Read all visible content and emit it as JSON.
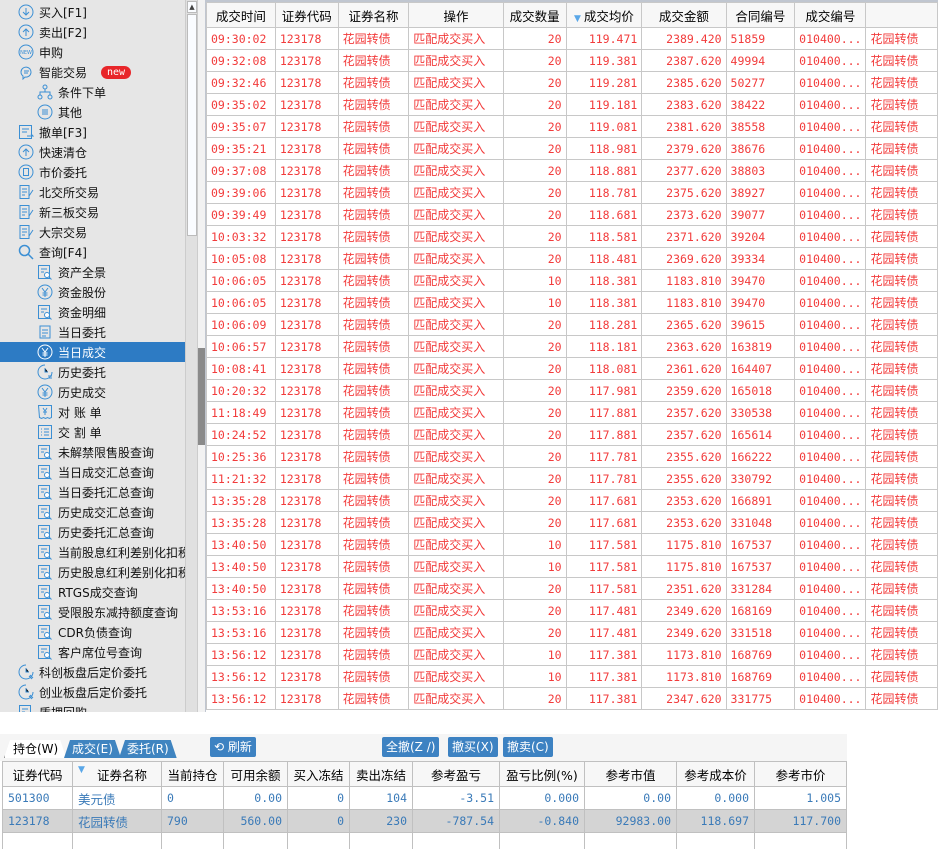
{
  "sidebar": {
    "items": [
      {
        "label": "买入[F1]",
        "level": 0,
        "icon": "buy-icon"
      },
      {
        "label": "卖出[F2]",
        "level": 0,
        "icon": "sell-icon"
      },
      {
        "label": "申购",
        "level": 0,
        "icon": "new-icon"
      },
      {
        "label": "智能交易",
        "level": 0,
        "icon": "smart-trade-icon",
        "badge": "new"
      },
      {
        "label": "条件下单",
        "level": 1,
        "icon": "tree-icon"
      },
      {
        "label": "其他",
        "level": 1,
        "icon": "list-circle-icon"
      },
      {
        "label": "撤单[F3]",
        "level": 0,
        "icon": "cancel-order-icon"
      },
      {
        "label": "快速清仓",
        "level": 0,
        "icon": "sell-icon"
      },
      {
        "label": "市价委托",
        "level": 0,
        "icon": "market-order-icon"
      },
      {
        "label": "北交所交易",
        "level": 0,
        "icon": "document-edit-icon"
      },
      {
        "label": "新三板交易",
        "level": 0,
        "icon": "document-edit-icon"
      },
      {
        "label": "大宗交易",
        "level": 0,
        "icon": "document-edit-icon"
      },
      {
        "label": "查询[F4]",
        "level": 0,
        "icon": "search-icon"
      },
      {
        "label": "资产全景",
        "level": 1,
        "icon": "report-search-icon"
      },
      {
        "label": "资金股份",
        "level": 1,
        "icon": "yuan-icon"
      },
      {
        "label": "资金明细",
        "level": 1,
        "icon": "report-search-icon"
      },
      {
        "label": "当日委托",
        "level": 1,
        "icon": "order-icon"
      },
      {
        "label": "当日成交",
        "level": 1,
        "icon": "yuan-icon",
        "selected": true
      },
      {
        "label": "历史委托",
        "level": 1,
        "icon": "history-icon"
      },
      {
        "label": "历史成交",
        "level": 1,
        "icon": "yuan-icon"
      },
      {
        "label": "对 账 单",
        "level": 1,
        "icon": "statement-icon"
      },
      {
        "label": "交 割 单",
        "level": 1,
        "icon": "list-icon"
      },
      {
        "label": "未解禁限售股查询",
        "level": 1,
        "icon": "report-search-icon"
      },
      {
        "label": "当日成交汇总查询",
        "level": 1,
        "icon": "report-search-icon"
      },
      {
        "label": "当日委托汇总查询",
        "level": 1,
        "icon": "report-search-icon"
      },
      {
        "label": "历史成交汇总查询",
        "level": 1,
        "icon": "report-search-icon"
      },
      {
        "label": "历史委托汇总查询",
        "level": 1,
        "icon": "report-search-icon"
      },
      {
        "label": "当前股息红利差别化扣税",
        "level": 1,
        "icon": "report-search-icon"
      },
      {
        "label": "历史股息红利差别化扣税",
        "level": 1,
        "icon": "report-search-icon"
      },
      {
        "label": "RTGS成交查询",
        "level": 1,
        "icon": "report-search-icon"
      },
      {
        "label": "受限股东减持额度查询",
        "level": 1,
        "icon": "report-search-icon"
      },
      {
        "label": "CDR负债查询",
        "level": 1,
        "icon": "report-search-icon"
      },
      {
        "label": "客户席位号查询",
        "level": 1,
        "icon": "report-search-icon"
      },
      {
        "label": "科创板盘后定价委托",
        "level": 0,
        "icon": "clock-icon"
      },
      {
        "label": "创业板盘后定价委托",
        "level": 0,
        "icon": "clock-icon"
      },
      {
        "label": "质押回购",
        "level": 0,
        "icon": "report-search-icon"
      }
    ]
  },
  "trades": {
    "columns": [
      "成交时间",
      "证券代码",
      "证券名称",
      "操作",
      "成交数量",
      "成交均价",
      "成交金额",
      "合同编号",
      "成交编号",
      ""
    ],
    "sorted_column": 5,
    "rows": [
      [
        "09:30:02",
        "123178",
        "花园转债",
        "匹配成交买入",
        "20",
        "119.471",
        "2389.420",
        "51859",
        "010400...",
        "花园转债"
      ],
      [
        "09:32:08",
        "123178",
        "花园转债",
        "匹配成交买入",
        "20",
        "119.381",
        "2387.620",
        "49994",
        "010400...",
        "花园转债"
      ],
      [
        "09:32:46",
        "123178",
        "花园转债",
        "匹配成交买入",
        "20",
        "119.281",
        "2385.620",
        "50277",
        "010400...",
        "花园转债"
      ],
      [
        "09:35:02",
        "123178",
        "花园转债",
        "匹配成交买入",
        "20",
        "119.181",
        "2383.620",
        "38422",
        "010400...",
        "花园转债"
      ],
      [
        "09:35:07",
        "123178",
        "花园转债",
        "匹配成交买入",
        "20",
        "119.081",
        "2381.620",
        "38558",
        "010400...",
        "花园转债"
      ],
      [
        "09:35:21",
        "123178",
        "花园转债",
        "匹配成交买入",
        "20",
        "118.981",
        "2379.620",
        "38676",
        "010400...",
        "花园转债"
      ],
      [
        "09:37:08",
        "123178",
        "花园转债",
        "匹配成交买入",
        "20",
        "118.881",
        "2377.620",
        "38803",
        "010400...",
        "花园转债"
      ],
      [
        "09:39:06",
        "123178",
        "花园转债",
        "匹配成交买入",
        "20",
        "118.781",
        "2375.620",
        "38927",
        "010400...",
        "花园转债"
      ],
      [
        "09:39:49",
        "123178",
        "花园转债",
        "匹配成交买入",
        "20",
        "118.681",
        "2373.620",
        "39077",
        "010400...",
        "花园转债"
      ],
      [
        "10:03:32",
        "123178",
        "花园转债",
        "匹配成交买入",
        "20",
        "118.581",
        "2371.620",
        "39204",
        "010400...",
        "花园转债"
      ],
      [
        "10:05:08",
        "123178",
        "花园转债",
        "匹配成交买入",
        "20",
        "118.481",
        "2369.620",
        "39334",
        "010400...",
        "花园转债"
      ],
      [
        "10:06:05",
        "123178",
        "花园转债",
        "匹配成交买入",
        "10",
        "118.381",
        "1183.810",
        "39470",
        "010400...",
        "花园转债"
      ],
      [
        "10:06:05",
        "123178",
        "花园转债",
        "匹配成交买入",
        "10",
        "118.381",
        "1183.810",
        "39470",
        "010400...",
        "花园转债"
      ],
      [
        "10:06:09",
        "123178",
        "花园转债",
        "匹配成交买入",
        "20",
        "118.281",
        "2365.620",
        "39615",
        "010400...",
        "花园转债"
      ],
      [
        "10:06:57",
        "123178",
        "花园转债",
        "匹配成交买入",
        "20",
        "118.181",
        "2363.620",
        "163819",
        "010400...",
        "花园转债"
      ],
      [
        "10:08:41",
        "123178",
        "花园转债",
        "匹配成交买入",
        "20",
        "118.081",
        "2361.620",
        "164407",
        "010400...",
        "花园转债"
      ],
      [
        "10:20:32",
        "123178",
        "花园转债",
        "匹配成交买入",
        "20",
        "117.981",
        "2359.620",
        "165018",
        "010400...",
        "花园转债"
      ],
      [
        "11:18:49",
        "123178",
        "花园转债",
        "匹配成交买入",
        "20",
        "117.881",
        "2357.620",
        "330538",
        "010400...",
        "花园转债"
      ],
      [
        "10:24:52",
        "123178",
        "花园转债",
        "匹配成交买入",
        "20",
        "117.881",
        "2357.620",
        "165614",
        "010400...",
        "花园转债"
      ],
      [
        "10:25:36",
        "123178",
        "花园转债",
        "匹配成交买入",
        "20",
        "117.781",
        "2355.620",
        "166222",
        "010400...",
        "花园转债"
      ],
      [
        "11:21:32",
        "123178",
        "花园转债",
        "匹配成交买入",
        "20",
        "117.781",
        "2355.620",
        "330792",
        "010400...",
        "花园转债"
      ],
      [
        "13:35:28",
        "123178",
        "花园转债",
        "匹配成交买入",
        "20",
        "117.681",
        "2353.620",
        "166891",
        "010400...",
        "花园转债"
      ],
      [
        "13:35:28",
        "123178",
        "花园转债",
        "匹配成交买入",
        "20",
        "117.681",
        "2353.620",
        "331048",
        "010400...",
        "花园转债"
      ],
      [
        "13:40:50",
        "123178",
        "花园转债",
        "匹配成交买入",
        "10",
        "117.581",
        "1175.810",
        "167537",
        "010400...",
        "花园转债"
      ],
      [
        "13:40:50",
        "123178",
        "花园转债",
        "匹配成交买入",
        "10",
        "117.581",
        "1175.810",
        "167537",
        "010400...",
        "花园转债"
      ],
      [
        "13:40:50",
        "123178",
        "花园转债",
        "匹配成交买入",
        "20",
        "117.581",
        "2351.620",
        "331284",
        "010400...",
        "花园转债"
      ],
      [
        "13:53:16",
        "123178",
        "花园转债",
        "匹配成交买入",
        "20",
        "117.481",
        "2349.620",
        "168169",
        "010400...",
        "花园转债"
      ],
      [
        "13:53:16",
        "123178",
        "花园转债",
        "匹配成交买入",
        "20",
        "117.481",
        "2349.620",
        "331518",
        "010400...",
        "花园转债"
      ],
      [
        "13:56:12",
        "123178",
        "花园转债",
        "匹配成交买入",
        "10",
        "117.381",
        "1173.810",
        "168769",
        "010400...",
        "花园转债"
      ],
      [
        "13:56:12",
        "123178",
        "花园转债",
        "匹配成交买入",
        "10",
        "117.381",
        "1173.810",
        "168769",
        "010400...",
        "花园转债"
      ],
      [
        "13:56:12",
        "123178",
        "花园转债",
        "匹配成交买入",
        "20",
        "117.381",
        "2347.620",
        "331775",
        "010400...",
        "花园转债"
      ]
    ]
  },
  "bottom": {
    "tabs": [
      "持仓(W)",
      "成交(E)",
      "委托(R)"
    ],
    "active_tab": 0,
    "buttons": {
      "refresh": "刷新",
      "cancel_all": "全撤(Z /)",
      "cancel_buy": "撤买(X)",
      "cancel_sell": "撤卖(C)"
    },
    "columns": [
      "证券代码",
      "证券名称",
      "当前持仓",
      "可用余额",
      "买入冻结",
      "卖出冻结",
      "参考盈亏",
      "盈亏比例(%)",
      "参考市值",
      "参考成本价",
      "参考市价"
    ],
    "sorted_column": 1,
    "rows": [
      [
        "501300",
        "美元债",
        "0",
        "0.00",
        "0",
        "104",
        "-3.51",
        "0.000",
        "0.00",
        "0.000",
        "1.005"
      ],
      [
        "123178",
        "花园转债",
        "790",
        "560.00",
        "0",
        "230",
        "-787.54",
        "-0.840",
        "92983.00",
        "118.697",
        "117.700"
      ]
    ]
  },
  "colors": {
    "trade_text": "#f23b3b",
    "position_text": "#3a7ab8",
    "selected": "#2d7bc4",
    "button": "#3d82c2"
  }
}
